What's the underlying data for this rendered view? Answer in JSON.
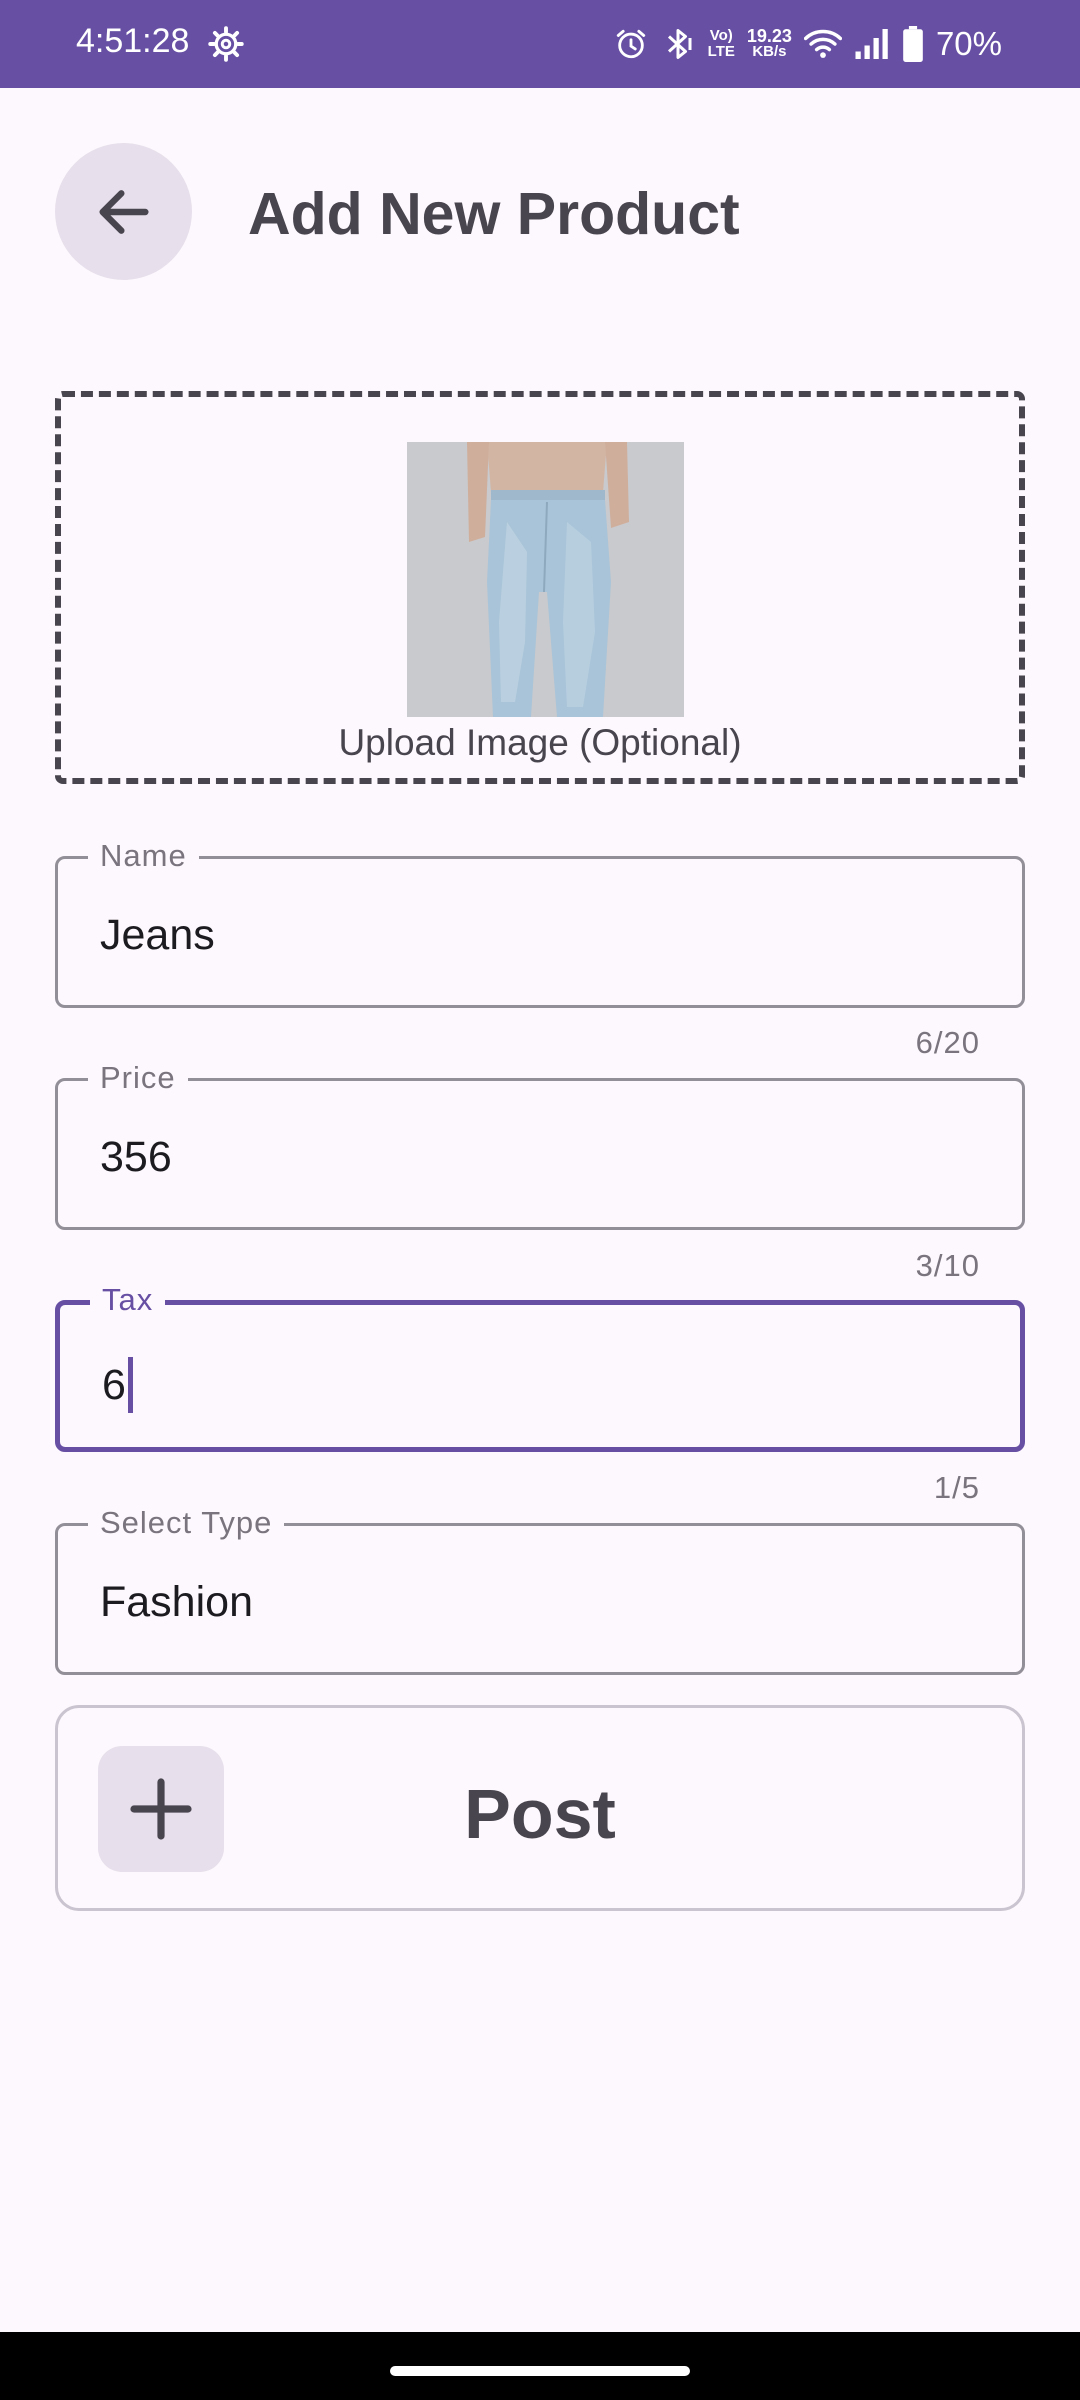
{
  "status_bar": {
    "time": "4:51:28",
    "volte": "Vo)",
    "lte": "LTE",
    "speed_value": "19.23",
    "speed_unit": "KB/s",
    "battery": "70%"
  },
  "header": {
    "title": "Add New Product"
  },
  "upload": {
    "label": "Upload Image (Optional)"
  },
  "form": {
    "name": {
      "label": "Name",
      "value": "Jeans",
      "counter": "6/20"
    },
    "price": {
      "label": "Price",
      "value": "356",
      "counter": "3/10"
    },
    "tax": {
      "label": "Tax",
      "value": "6",
      "counter": "1/5"
    },
    "type": {
      "label": "Select Type",
      "value": "Fashion"
    }
  },
  "post_button": {
    "label": "Post"
  },
  "colors": {
    "primary": "#6750a4",
    "surface": "#fdf8fd",
    "on_surface_variant": "#49454f",
    "outline": "#938f99"
  },
  "icons": {
    "back": "arrow-left-icon",
    "add": "plus-icon",
    "settings": "gear-icon",
    "alarm": "alarm-icon",
    "bluetooth": "bluetooth-icon",
    "wifi": "wifi-icon",
    "signal": "signal-icon",
    "battery": "battery-icon"
  }
}
